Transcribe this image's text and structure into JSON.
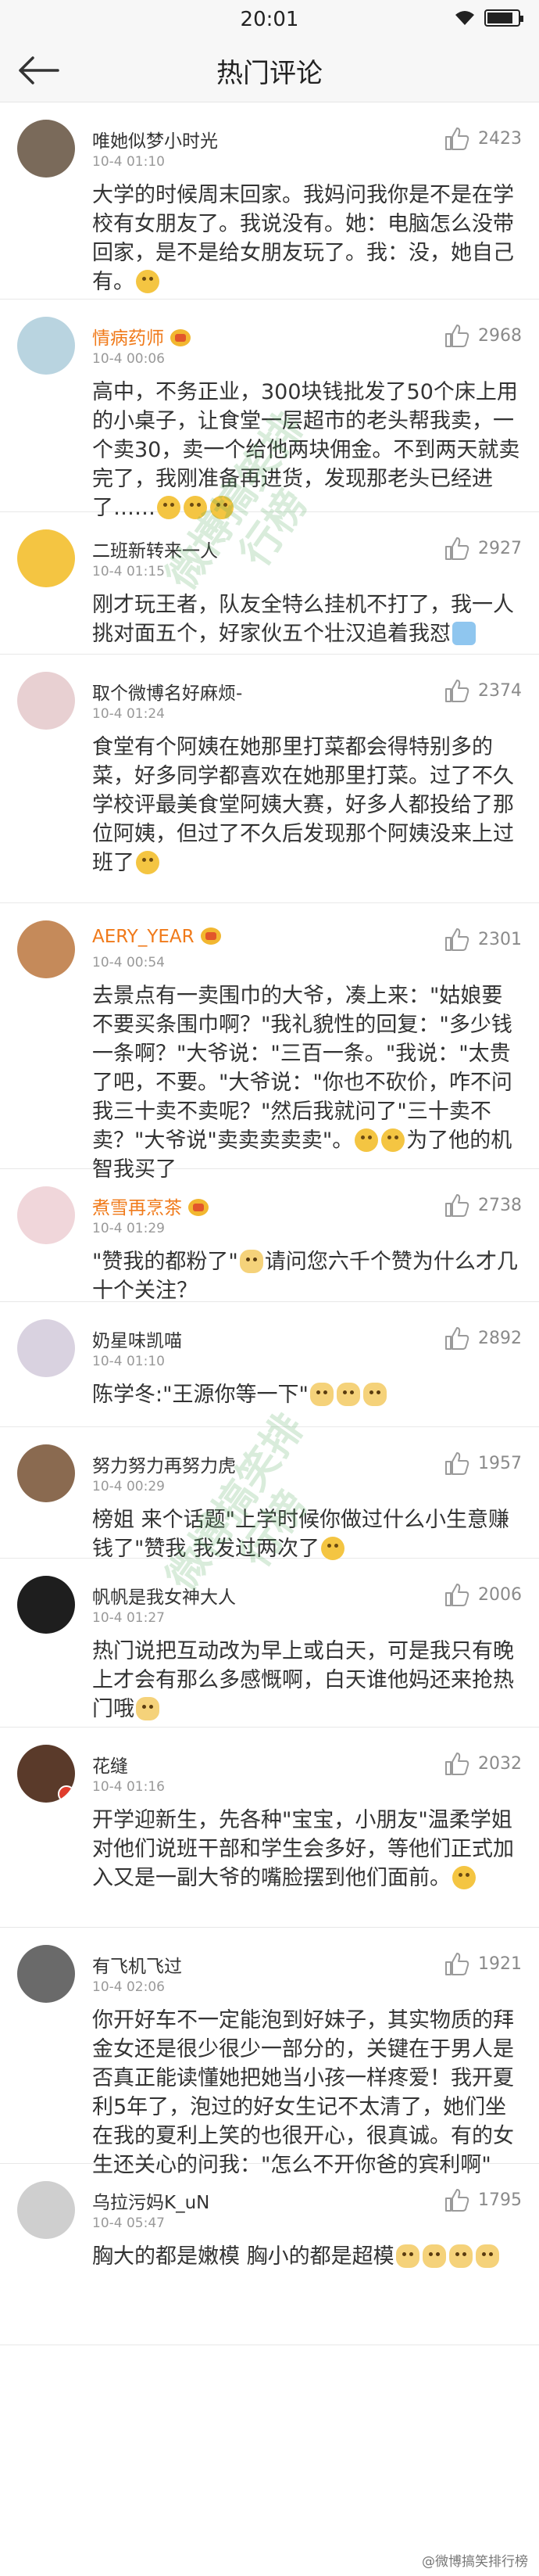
{
  "status_bar": {
    "time": "20:01"
  },
  "nav": {
    "title": "热门评论"
  },
  "watermark": "微博搞笑排行榜",
  "footer_mark": "@微博搞笑排行榜",
  "colors": {
    "orange_name": "#f07a1a",
    "like_gray": "#8a8a8a",
    "time_gray": "#999999"
  },
  "comments": [
    {
      "user": "唯她似梦小时光",
      "time": "10-4 01:10",
      "likes": "2423",
      "text": "大学的时候周末回家。我妈问我你是不是在学校有女朋友了。我说没有。她：电脑怎么没带回家，是不是给女朋友玩了。我：没，她自己有。",
      "emojis": [
        "smile"
      ],
      "orange": false,
      "badge": false
    },
    {
      "user": "情病药师",
      "time": "10-4 00:06",
      "likes": "2968",
      "text": "高中，不务正业，300块钱批发了50个床上用的小桌子，让食堂一层超市的老头帮我卖，一个卖30，卖一个给他两块佣金。不到两天就卖完了，我刚准备再进货，发现那老头已经进了……",
      "emojis": [
        "smile",
        "smile",
        "smile"
      ],
      "orange": true,
      "badge": true
    },
    {
      "user": "二班新转来一人",
      "time": "10-4 01:15",
      "likes": "2927",
      "text": "刚才玩王者，队友全特么挂机不打了，我一人挑对面五个，好家伙五个壮汉追着我怼",
      "emojis": [
        "toilet"
      ],
      "orange": false,
      "badge": false
    },
    {
      "user": "取个微博名好麻烦-",
      "time": "10-4 01:24",
      "likes": "2374",
      "text": "食堂有个阿姨在她那里打菜都会得特别多的菜，好多同学都喜欢在她那里打菜。过了不久学校评最美食堂阿姨大赛，好多人都投给了那位阿姨，但过了不久后发现那个阿姨没来上过班了",
      "emojis": [
        "smile"
      ],
      "orange": false,
      "badge": false
    },
    {
      "user": "AERY_YEAR",
      "time": "10-4 00:54",
      "likes": "2301",
      "text": "去景点有一卖围巾的大爷，凑上来：\"姑娘要不要买条围巾啊？\"我礼貌性的回复：\"多少钱一条啊？\"大爷说：\"三百一条。\"我说：\"太贵了吧，不要。\"大爷说：\"你也不砍价，咋不问我三十卖不卖呢？\"然后我就问了\"三十卖不卖？\"大爷说\"卖卖卖卖卖\"。",
      "emojis": [
        "smile",
        "smile"
      ],
      "tail": "为了他的机智我买了",
      "orange": true,
      "badge": true
    },
    {
      "user": "煮雪再烹茶",
      "time": "10-4 01:29",
      "likes": "2738",
      "text": "\"赞我的都粉了\"",
      "emojis": [
        "cat"
      ],
      "tail": "请问您六千个赞为什么才几十个关注？",
      "orange": true,
      "badge": true
    },
    {
      "user": "奶星味凯喵",
      "time": "10-4 01:10",
      "likes": "2892",
      "text": "陈学冬:\"王源你等一下\"",
      "emojis": [
        "cat",
        "cat",
        "cat"
      ],
      "orange": false,
      "badge": false
    },
    {
      "user": "努力努力再努力虎",
      "time": "10-4 00:29",
      "likes": "1957",
      "text": "榜姐 来个话题\"上学时候你做过什么小生意赚钱了\"赞我 我发过两次了",
      "emojis": [
        "smile"
      ],
      "orange": false,
      "badge": false
    },
    {
      "user": "帆帆是我女神大人",
      "time": "10-4 01:27",
      "likes": "2006",
      "text": "热门说把互动改为早上或白天，可是我只有晚上才会有那么多感慨啊，白天谁他妈还来抢热门哦",
      "emojis": [
        "cat"
      ],
      "orange": false,
      "badge": false
    },
    {
      "user": "花缝",
      "time": "10-4 01:16",
      "likes": "2032",
      "text": "开学迎新生，先各种\"宝宝，小朋友\"温柔学姐对他们说班干部和学生会多好，等他们正式加入又是一副大爷的嘴脸摆到他们面前。",
      "emojis": [
        "smile"
      ],
      "orange": false,
      "badge": false,
      "vbadge": true
    },
    {
      "user": "有飞机飞过",
      "time": "10-4 02:06",
      "likes": "1921",
      "text": "你开好车不一定能泡到好妹子，其实物质的拜金女还是很少很少一部分的，关键在于男人是否真正能读懂她把她当小孩一样疼爱！我开夏利5年了，泡过的好女生记不太清了，她们坐在我的夏利上笑的也很开心，很真诚。有的女生还关心的问我：\"怎么不开你爸的宾利啊\"",
      "emojis": [],
      "orange": false,
      "badge": false
    },
    {
      "user": "乌拉污妈K_uN",
      "time": "10-4 05:47",
      "likes": "1795",
      "text": "胸大的都是嫩模  胸小的都是超模",
      "emojis": [
        "cat",
        "cat",
        "cat",
        "cat"
      ],
      "orange": false,
      "badge": false
    }
  ]
}
